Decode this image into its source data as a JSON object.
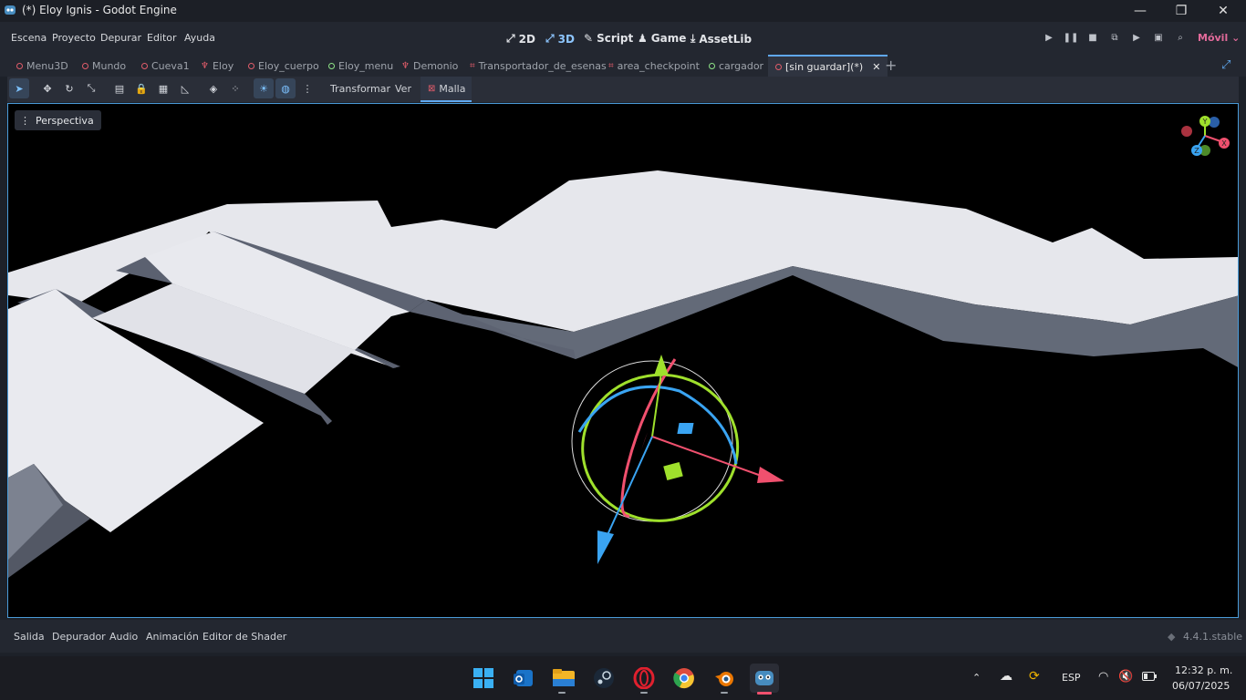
{
  "window": {
    "title": "(*) Eloy Ignis - Godot Engine",
    "minimize": "—",
    "maximize": "❐",
    "close": "✕"
  },
  "menu": [
    "Escena",
    "Proyecto",
    "Depurar",
    "Editor",
    "Ayuda"
  ],
  "workspaces": [
    {
      "icon": "⤢",
      "label": "2D"
    },
    {
      "icon": "⤢",
      "label": "3D"
    },
    {
      "icon": "✎",
      "label": "Script"
    },
    {
      "icon": "♟",
      "label": "Game"
    },
    {
      "icon": "⤓",
      "label": "AssetLib"
    }
  ],
  "run_controls": [
    "▶",
    "❚❚",
    "■",
    "⧉",
    "▶",
    "▣",
    "⌕"
  ],
  "renderer": "Móvil",
  "scene_tabs": [
    {
      "label": "Menu3D",
      "icon": "circle"
    },
    {
      "label": "Mundo",
      "icon": "circle"
    },
    {
      "label": "Cueva1",
      "icon": "circle"
    },
    {
      "label": "Eloy",
      "icon": "character"
    },
    {
      "label": "Eloy_cuerpo",
      "icon": "circle"
    },
    {
      "label": "Eloy_menu",
      "icon": "green-circle"
    },
    {
      "label": "Demonio",
      "icon": "character"
    },
    {
      "label": "Transportador_de_esenas",
      "icon": "area"
    },
    {
      "label": "area_checkpoint",
      "icon": "area"
    },
    {
      "label": "cargador",
      "icon": "green-circle"
    },
    {
      "label": "[sin guardar](*)",
      "icon": "circle",
      "active": true
    }
  ],
  "toolbar": {
    "tools": [
      "➤",
      "✥",
      "↻",
      "⤡",
      "▤",
      "🔒",
      "▦",
      "◺",
      "◈",
      "⁘",
      "☀",
      "◍",
      "⋮"
    ],
    "transformar": "Transformar",
    "ver": "Ver",
    "malla": "Malla"
  },
  "viewport": {
    "perspective_label": "Perspectiva",
    "gizmo_axes": [
      "Y",
      "X",
      "Z"
    ]
  },
  "bottom_panel": {
    "items": [
      "Salida",
      "Depurador",
      "Audio",
      "Animación",
      "Editor de Shader"
    ],
    "version": "4.4.1.stable"
  },
  "taskbar": {
    "language": "ESP",
    "time": "12:32 p. m.",
    "date": "06/07/2025"
  },
  "colors": {
    "accent": "#5fa8f0",
    "x_axis": "#f0506e",
    "y_axis": "#9fe02c",
    "z_axis": "#3aa4f2",
    "renderer": "#e26a9a"
  }
}
